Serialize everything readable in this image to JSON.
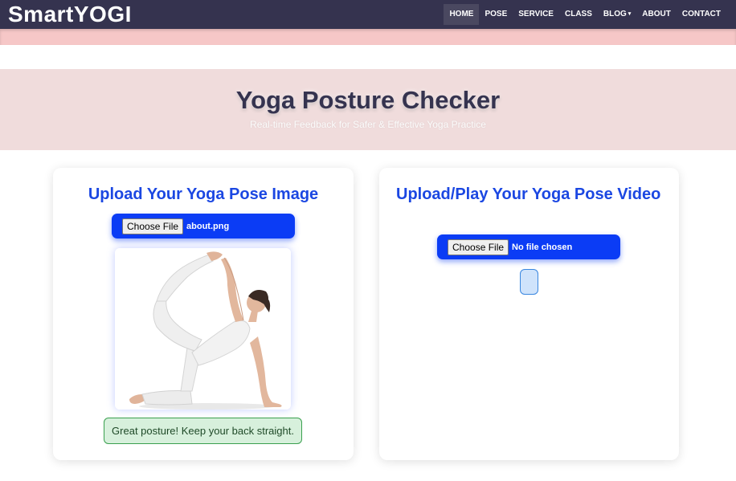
{
  "brand": "SmartYOGI",
  "nav": {
    "items": [
      {
        "label": "HOME",
        "active": true
      },
      {
        "label": "POSE"
      },
      {
        "label": "SERVICE"
      },
      {
        "label": "CLASS"
      },
      {
        "label": "BLOG",
        "has_dropdown": true
      },
      {
        "label": "ABOUT"
      },
      {
        "label": "CONTACT"
      }
    ]
  },
  "hero": {
    "title": "Yoga Posture Checker",
    "subtitle": "Real-time Feedback for Safer & Effective Yoga Practice"
  },
  "image_card": {
    "title": "Upload Your Yoga Pose Image",
    "choose_file_label": "Choose File",
    "file_name": "about.png",
    "feedback": "Great posture! Keep your back straight."
  },
  "video_card": {
    "title": "Upload/Play Your Yoga Pose Video",
    "choose_file_label": "Choose File",
    "file_name": "No file chosen"
  },
  "colors": {
    "navbar": "#35334f",
    "accent_blue": "#0b3cf5",
    "title_blue": "#1b47e2",
    "hero_bg": "#f0dcdc",
    "feedback_bg": "#d7f0dc"
  }
}
